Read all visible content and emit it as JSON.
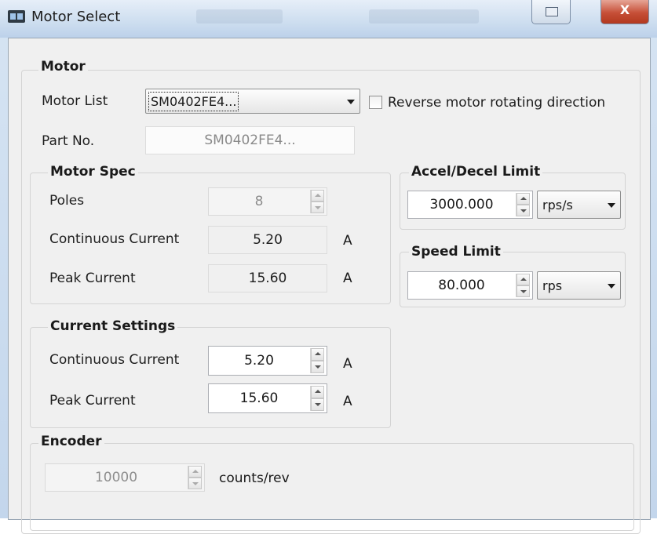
{
  "window": {
    "title": "Motor Select"
  },
  "motor": {
    "group_title": "Motor",
    "motor_list_label": "Motor List",
    "motor_list_value": "SM0402FE4...",
    "reverse_label": "Reverse motor rotating direction",
    "reverse_checked": false,
    "part_no_label": "Part No.",
    "part_no_value": "SM0402FE4..."
  },
  "motor_spec": {
    "group_title": "Motor Spec",
    "poles_label": "Poles",
    "poles_value": "8",
    "cont_current_label": "Continuous Current",
    "cont_current_value": "5.20",
    "cont_current_unit": "A",
    "peak_current_label": "Peak Current",
    "peak_current_value": "15.60",
    "peak_current_unit": "A"
  },
  "current_settings": {
    "group_title": "Current Settings",
    "cont_current_label": "Continuous Current",
    "cont_current_value": "5.20",
    "cont_current_unit": "A",
    "peak_current_label": "Peak Current",
    "peak_current_value": "15.60",
    "peak_current_unit": "A"
  },
  "accel": {
    "group_title": "Accel/Decel Limit",
    "value": "3000.000",
    "unit": "rps/s"
  },
  "speed": {
    "group_title": "Speed Limit",
    "value": "80.000",
    "unit": "rps"
  },
  "encoder": {
    "group_title": "Encoder",
    "value": "10000",
    "unit": "counts/rev"
  }
}
